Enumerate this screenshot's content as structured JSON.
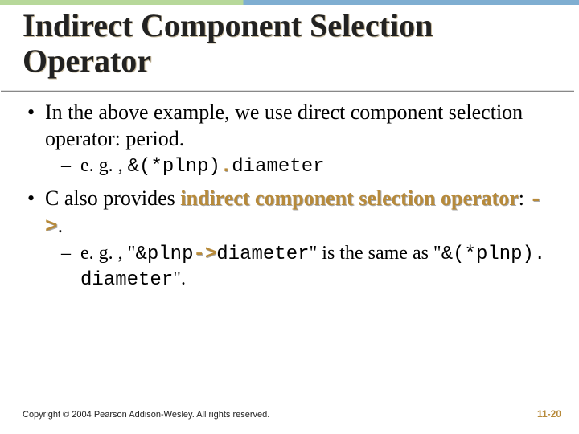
{
  "title": "Indirect Component Selection Operator",
  "bullets": {
    "b1": {
      "text_a": "In the above example, we use direct component selection operator: period.",
      "sub1_prefix": "e. g. , ",
      "sub1_code": "&(*plnp)",
      "sub1_dot": ".",
      "sub1_rest": "diameter"
    },
    "b2": {
      "text_a": "C also provides ",
      "hl": "indirect component selection operator",
      "text_b": ": ",
      "arrow": "->",
      "text_c": ".",
      "sub1_prefix": "e. g. , \"",
      "sub1_code_a": "&plnp",
      "sub1_arrow": "->",
      "sub1_code_b": "diameter",
      "sub1_mid": "\" is the same as \"",
      "sub1_code_c": "&(*plnp). diameter",
      "sub1_end": "\"."
    }
  },
  "footer": {
    "copyright": "Copyright © 2004 Pearson Addison-Wesley. All rights reserved.",
    "pagenum": "11-20"
  }
}
